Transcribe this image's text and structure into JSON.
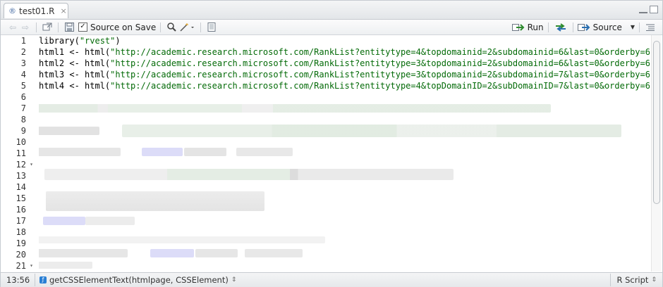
{
  "tab": {
    "title": "test01.R",
    "close": "×"
  },
  "toolbar": {
    "source_on_save": "Source on Save",
    "run": "Run",
    "source": "Source"
  },
  "line_numbers": [
    "1",
    "2",
    "3",
    "4",
    "5",
    "6",
    "7",
    "8",
    "9",
    "10",
    "11",
    "12",
    "13",
    "14",
    "15",
    "16",
    "17",
    "18",
    "19",
    "20",
    "21"
  ],
  "code_lines": [
    {
      "kw": "library",
      "rest_a": "(",
      "str": "\"rvest\"",
      "rest_b": ")"
    },
    {
      "kw": "html1 ",
      "rest_a": "<- html(",
      "str": "\"http://academic.research.microsoft.com/RankList?entitytype=4&topdomainid=2&subdomainid=6&last=0&orderby=6\"",
      "rest_b": ")"
    },
    {
      "kw": "html2 ",
      "rest_a": "<- html(",
      "str": "\"http://academic.research.microsoft.com/RankList?entitytype=3&topdomainid=2&subdomainid=6&last=0&orderby=6\"",
      "rest_b": ")"
    },
    {
      "kw": "html3 ",
      "rest_a": "<- html(",
      "str": "\"http://academic.research.microsoft.com/RankList?entitytype=3&topdomainid=2&subdomainid=7&last=0&orderby=6\"",
      "rest_b": ")"
    },
    {
      "kw": "html4 ",
      "rest_a": "<- html(",
      "str": "\"http://academic.research.microsoft.com/RankList?entitytype=4&topDomainID=2&subDomainID=7&last=0&orderby=6\"",
      "rest_b": ")"
    }
  ],
  "status": {
    "cursor": "13:56",
    "function": "getCSSElementText(htmlpage, CSSElement)",
    "file_type": "R Script"
  }
}
